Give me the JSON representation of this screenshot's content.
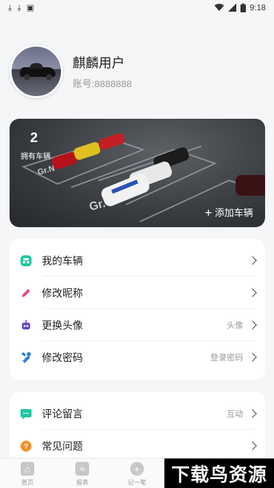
{
  "status_bar": {
    "time": "9:18",
    "left_icons": [
      "download-icon",
      "download-icon",
      "app-notification-icon"
    ],
    "right_icons": [
      "wifi-icon",
      "signal-icon",
      "battery-icon"
    ]
  },
  "profile": {
    "username": "麒麟用户",
    "account": "账号:8888888"
  },
  "banner": {
    "vehicle_count": "2",
    "vehicle_count_label": "拥有车辆",
    "add_vehicle_label": "添加车辆",
    "floor_labels": [
      "Gr.N",
      "Gr.4"
    ]
  },
  "menu_group_1": [
    {
      "label": "我的车辆",
      "hint": "",
      "icon": "car-icon",
      "color": "#1cc6a0"
    },
    {
      "label": "修改昵称",
      "hint": "",
      "icon": "pencil-icon",
      "color": "#e04b8f"
    },
    {
      "label": "更换头像",
      "hint": "头像",
      "icon": "robot-icon",
      "color": "#6a45c9"
    },
    {
      "label": "修改密码",
      "hint": "登录密码",
      "icon": "wrench-icon",
      "color": "#2a7de1"
    }
  ],
  "menu_group_2": [
    {
      "label": "评论留言",
      "hint": "互动",
      "icon": "comment-icon",
      "color": "#1cc6a0"
    },
    {
      "label": "常见问题",
      "hint": "",
      "icon": "question-icon",
      "color": "#f2932a"
    }
  ],
  "bottom_nav": [
    {
      "label": "首页",
      "icon": "home-icon"
    },
    {
      "label": "报表",
      "icon": "report-icon"
    },
    {
      "label": "记一笔",
      "icon": "add-record-icon"
    }
  ],
  "watermark": "下载鸟资源"
}
